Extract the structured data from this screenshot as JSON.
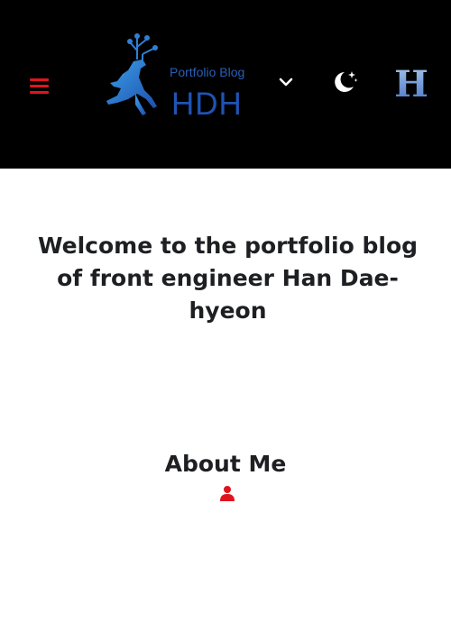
{
  "header": {
    "logo": {
      "subtitle": "Portfolio Blog",
      "title": "HDH"
    },
    "badge_letter": "H",
    "icons": {
      "menu": "hamburger-menu-icon",
      "dropdown": "chevron-down-icon",
      "theme": "moon-stars-icon"
    }
  },
  "hero": {
    "title": "Welcome to the portfolio blog of front engineer Han Dae-hyeon"
  },
  "about": {
    "title": "About Me",
    "icon": "user-icon"
  },
  "colors": {
    "header_bg": "#000000",
    "accent_red": "#e0141e",
    "logo_blue": "#1f53b4",
    "text_dark": "#1e1f22"
  }
}
